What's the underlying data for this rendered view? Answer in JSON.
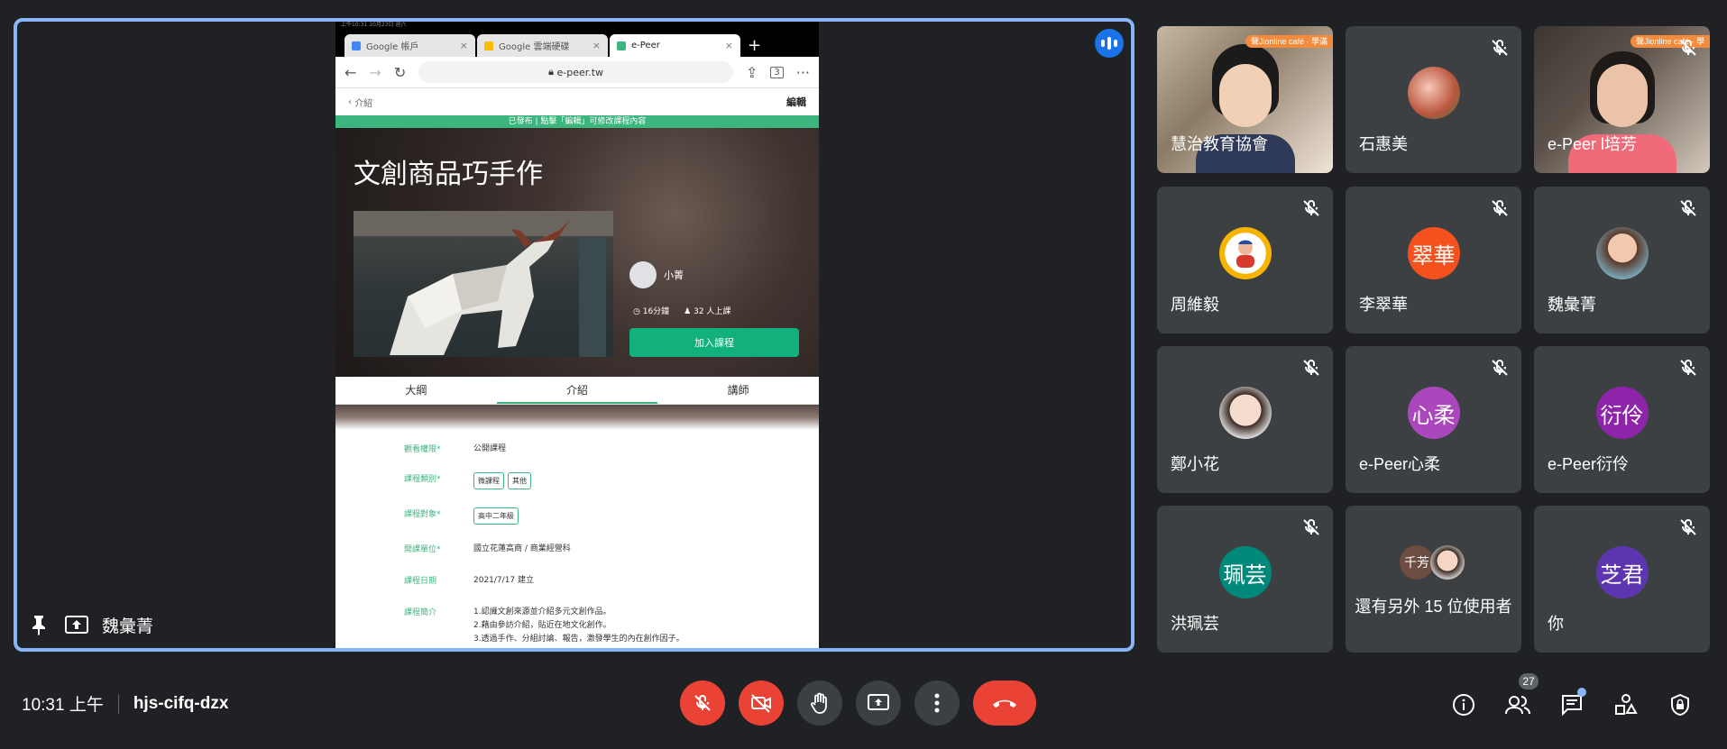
{
  "presenter": {
    "name": "魏彙菁"
  },
  "ipad": {
    "status_left": "上午10:31  10月23日 週六",
    "tabs": [
      {
        "label": "Google 帳戶"
      },
      {
        "label": "Google 雲端硬碟"
      },
      {
        "label": "e-Peer"
      }
    ],
    "url": "e-peer.tw",
    "tab_count": "3",
    "breadcrumb": "介紹",
    "edit_label": "編輯",
    "notice": "已發布 | 點擊「編輯」可修改課程內容",
    "course_title": "文創商品巧手作",
    "author": "小菁",
    "duration": "16分鐘",
    "enrolled": "32 人上課",
    "join_label": "加入課程",
    "content_tabs": [
      "大綱",
      "介紹",
      "講師"
    ],
    "fields": {
      "visibility": {
        "k": "觀看權限*",
        "v": "公開課程"
      },
      "category": {
        "k": "課程類別*",
        "chips": [
          "微課程",
          "其他"
        ]
      },
      "audience": {
        "k": "課程對象*",
        "chips": [
          "高中二年級"
        ]
      },
      "unit": {
        "k": "開課單位*",
        "v": "國立花蓮高商 / 商業經營科"
      },
      "date": {
        "k": "課程日期",
        "v": "2021/7/17 建立"
      },
      "intro": {
        "k": "課程簡介",
        "lines": [
          "1.認識文創來源並介紹多元文創作品。",
          "2.藉由參訪介紹，貼近在地文化創作。",
          "3.透過手作、分組討論、報告，激發學生的內在創作因子。"
        ]
      }
    }
  },
  "participants": [
    {
      "name": "慧治教育協會",
      "banner": "聲Jionline café · 學滿"
    },
    {
      "name": "石惠美"
    },
    {
      "name": "e-Peer l培芳",
      "banner": "聲Jionline café · 學"
    },
    {
      "name": "周維毅"
    },
    {
      "name": "李翠華",
      "initials": "翠華",
      "color": "#f4511e"
    },
    {
      "name": "魏彙菁"
    },
    {
      "name": "鄭小花"
    },
    {
      "name": "e-Peer心柔",
      "initials": "心柔",
      "color": "#ab47bc"
    },
    {
      "name": "e-Peer衍伶",
      "initials": "衍伶",
      "color": "#8e24aa"
    },
    {
      "name": "洪珮芸",
      "initials": "珮芸",
      "color": "#00897b"
    },
    {
      "name": "還有另外 15 位使用者",
      "initials": "千芳",
      "color": "#6d4c41"
    },
    {
      "name": "你",
      "initials": "芝君",
      "color": "#5e35b1"
    }
  ],
  "bottom": {
    "time": "10:31 上午",
    "meeting_code": "hjs-cifq-dzx",
    "people_count": "27"
  },
  "colors": {
    "accent_red": "#ea4335",
    "stage_border": "#8ab4f8",
    "epeer_green": "#3db57e"
  }
}
